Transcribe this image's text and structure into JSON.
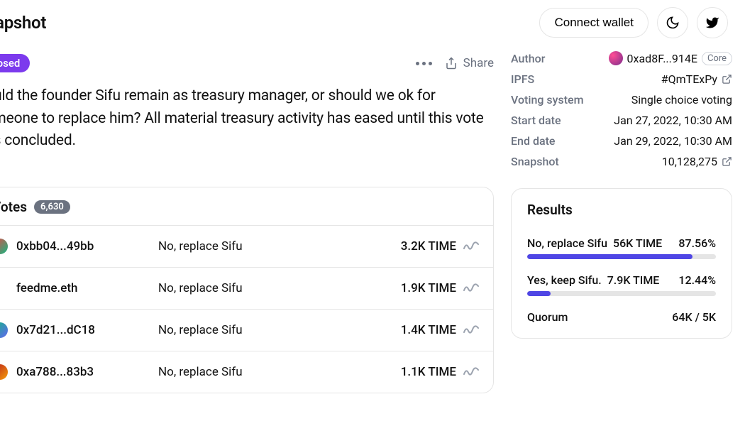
{
  "header": {
    "title": "napshot",
    "connect_label": "Connect wallet"
  },
  "proposal": {
    "status_label": "Closed",
    "share_label": "Share",
    "description": "hould the founder Sifu remain as treasury manager, or should we ok for someone to replace him? All material treasury activity has eased until this vote has concluded."
  },
  "votes": {
    "title": "Votes",
    "count": "6,630",
    "rows": [
      {
        "addr": "0xbb04...49bb",
        "choice": "No, replace Sifu",
        "amount": "3.2K TIME",
        "avatar_class": "avatar0",
        "has_avatar": true
      },
      {
        "addr": "feedme.eth",
        "choice": "No, replace Sifu",
        "amount": "1.9K TIME",
        "avatar_class": "avatar1",
        "has_avatar": false
      },
      {
        "addr": "0x7d21...dC18",
        "choice": "No, replace Sifu",
        "amount": "1.4K TIME",
        "avatar_class": "avatar2",
        "has_avatar": true
      },
      {
        "addr": "0xa788...83b3",
        "choice": "No, replace Sifu",
        "amount": "1.1K TIME",
        "avatar_class": "avatar3",
        "has_avatar": true
      }
    ]
  },
  "meta": {
    "author_label": "Author",
    "author_value": "0xad8F...914E",
    "core_label": "Core",
    "ipfs_label": "IPFS",
    "ipfs_value": "#QmTExPy",
    "voting_system_label": "Voting system",
    "voting_system_value": "Single choice voting",
    "start_label": "Start date",
    "start_value": "Jan 27, 2022, 10:30 AM",
    "end_label": "End date",
    "end_value": "Jan 29, 2022, 10:30 AM",
    "snapshot_label": "Snapshot",
    "snapshot_value": "10,128,275"
  },
  "results": {
    "title": "Results",
    "options": [
      {
        "label": "No, replace Sifu",
        "amount": "56K TIME",
        "percent": "87.56%",
        "width": "87.56%"
      },
      {
        "label": "Yes, keep Sifu.",
        "amount": "7.9K TIME",
        "percent": "12.44%",
        "width": "12.44%"
      }
    ],
    "quorum_label": "Quorum",
    "quorum_value": "64K / 5K"
  }
}
